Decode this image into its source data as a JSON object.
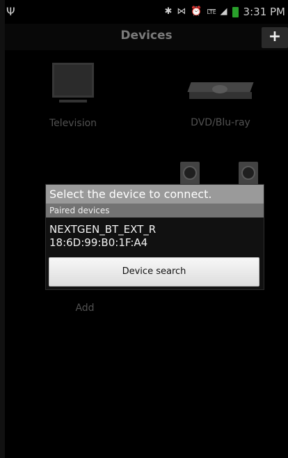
{
  "status_bar": {
    "usb_icon": "usb-icon",
    "bluetooth_icon": "bluetooth-icon",
    "signal_icon": "signal-icon",
    "alarm_icon": "alarm-icon",
    "network": "LTE",
    "battery_icon": "battery-icon",
    "time": "3:31 PM"
  },
  "header": {
    "title": "Devices",
    "add_label": "+"
  },
  "devices": {
    "tv_label": "Television",
    "dvd_label": "DVD/Blu-ray",
    "add_label": "Add"
  },
  "dialog": {
    "title": "Select the device to connect.",
    "section": "Paired devices",
    "device_name": "NEXTGEN_BT_EXT_R",
    "device_address": "18:6D:99:B0:1F:A4",
    "search_label": "Device search"
  },
  "colors": {
    "background": "#000000",
    "dialog_title": "#9a9a9a",
    "section_header": "#737373",
    "button": "#e8e8e8"
  }
}
